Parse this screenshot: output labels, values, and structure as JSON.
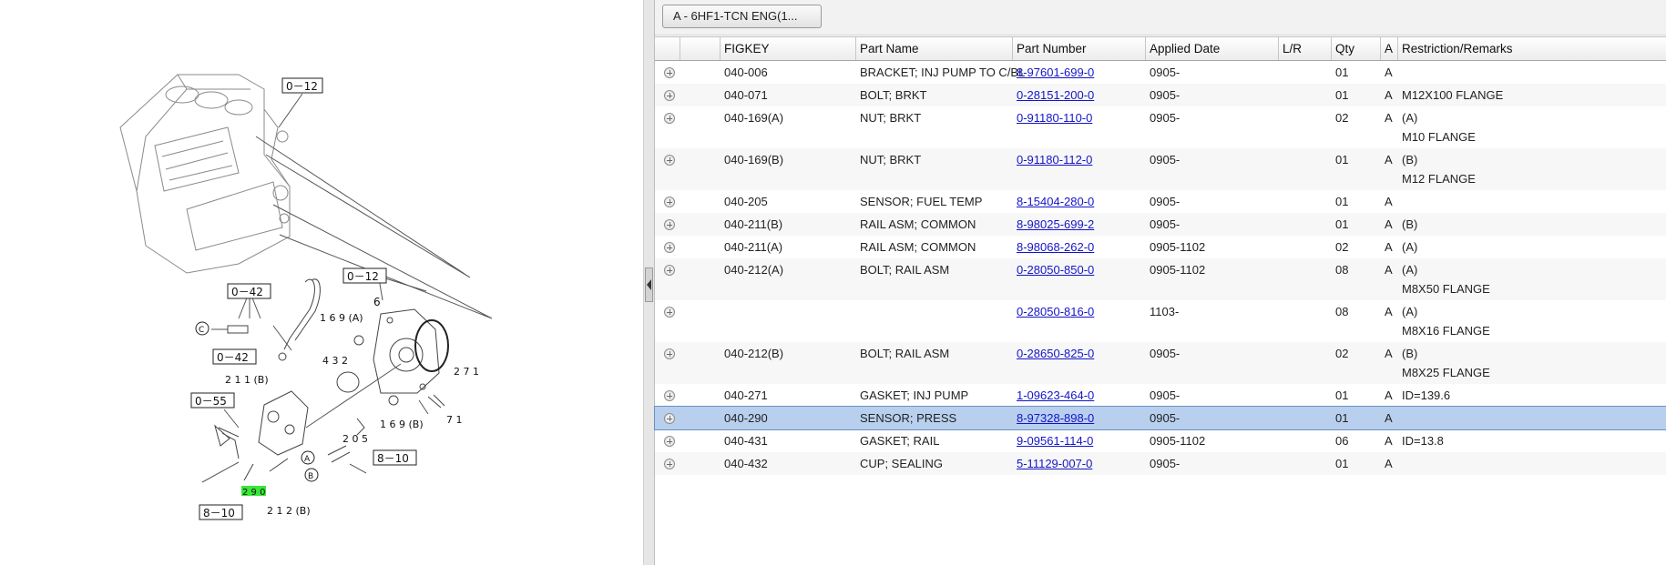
{
  "diagram": {
    "callouts": {
      "c1": "0－12",
      "c2": "0－12",
      "c3": "0－42",
      "c4": "0－42",
      "c5": "0－55",
      "c6": "8－10",
      "c7": "8－10"
    },
    "labels": {
      "n6": "6",
      "n169a": "1 6 9 (A)",
      "n169b": "1 6 9 (B)",
      "n432": "4 3 2",
      "n271": "2 7 1",
      "n71": "7 1",
      "n211b": "2 1 1 (B)",
      "n205": "2 0 5",
      "n212b": "2 1 2 (B)",
      "n290": "2 9 0"
    },
    "markers": {
      "c": "C",
      "a": "A",
      "b": "B"
    },
    "highlight_color": "#39e639"
  },
  "toolbar": {
    "selector_label": "A - 6HF1-TCN ENG(1..."
  },
  "grid": {
    "columns": [
      "",
      "",
      "FIGKEY",
      "Part Name",
      "Part Number",
      "Applied Date",
      "L/R",
      "Qty",
      "A",
      "Restriction/Remarks"
    ],
    "rows": [
      {
        "figkey": "040-006",
        "name": "BRACKET; INJ PUMP TO C/BL",
        "part": "8-97601-699-0",
        "date": "0905-",
        "lr": "",
        "qty": "01",
        "a": "A",
        "r1": "",
        "r2": ""
      },
      {
        "figkey": "040-071",
        "name": "BOLT; BRKT",
        "part": "0-28151-200-0",
        "date": "0905-",
        "lr": "",
        "qty": "01",
        "a": "A",
        "r1": "M12X100 FLANGE",
        "r2": ""
      },
      {
        "figkey": "040-169(A)",
        "name": "NUT; BRKT",
        "part": "0-91180-110-0",
        "date": "0905-",
        "lr": "",
        "qty": "02",
        "a": "A",
        "r1": "(A)",
        "r2": "M10 FLANGE"
      },
      {
        "figkey": "040-169(B)",
        "name": "NUT; BRKT",
        "part": "0-91180-112-0",
        "date": "0905-",
        "lr": "",
        "qty": "01",
        "a": "A",
        "r1": "(B)",
        "r2": "M12 FLANGE"
      },
      {
        "figkey": "040-205",
        "name": "SENSOR; FUEL TEMP",
        "part": "8-15404-280-0",
        "date": "0905-",
        "lr": "",
        "qty": "01",
        "a": "A",
        "r1": "",
        "r2": ""
      },
      {
        "figkey": "040-211(B)",
        "name": "RAIL ASM; COMMON",
        "part": "8-98025-699-2",
        "date": "0905-",
        "lr": "",
        "qty": "01",
        "a": "A",
        "r1": "(B)",
        "r2": ""
      },
      {
        "figkey": "040-211(A)",
        "name": "RAIL ASM; COMMON",
        "part": "8-98068-262-0",
        "date": "0905-1102",
        "lr": "",
        "qty": "02",
        "a": "A",
        "r1": "(A)",
        "r2": ""
      },
      {
        "figkey": "040-212(A)",
        "name": "BOLT; RAIL ASM",
        "part": "0-28050-850-0",
        "date": "0905-1102",
        "lr": "",
        "qty": "08",
        "a": "A",
        "r1": "(A)",
        "r2": "M8X50 FLANGE"
      },
      {
        "figkey": "",
        "name": "",
        "part": "0-28050-816-0",
        "date": "1103-",
        "lr": "",
        "qty": "08",
        "a": "A",
        "r1": "(A)",
        "r2": "M8X16 FLANGE"
      },
      {
        "figkey": "040-212(B)",
        "name": "BOLT; RAIL ASM",
        "part": "0-28650-825-0",
        "date": "0905-",
        "lr": "",
        "qty": "02",
        "a": "A",
        "r1": "(B)",
        "r2": "M8X25 FLANGE"
      },
      {
        "figkey": "040-271",
        "name": "GASKET; INJ PUMP",
        "part": "1-09623-464-0",
        "date": "0905-",
        "lr": "",
        "qty": "01",
        "a": "A",
        "r1": "ID=139.6",
        "r2": ""
      },
      {
        "figkey": "040-290",
        "name": "SENSOR; PRESS",
        "part": "8-97328-898-0",
        "date": "0905-",
        "lr": "",
        "qty": "01",
        "a": "A",
        "r1": "",
        "r2": "",
        "selected": true
      },
      {
        "figkey": "040-431",
        "name": "GASKET; RAIL",
        "part": "9-09561-114-0",
        "date": "0905-1102",
        "lr": "",
        "qty": "06",
        "a": "A",
        "r1": "ID=13.8",
        "r2": ""
      },
      {
        "figkey": "040-432",
        "name": "CUP; SEALING",
        "part": "5-11129-007-0",
        "date": "0905-",
        "lr": "",
        "qty": "01",
        "a": "A",
        "r1": "",
        "r2": ""
      }
    ]
  }
}
